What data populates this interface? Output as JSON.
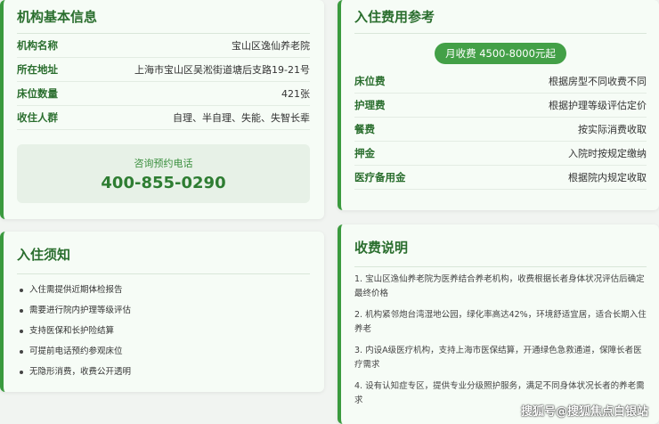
{
  "info": {
    "title": "机构基本信息",
    "rows": [
      {
        "label": "机构名称",
        "value": "宝山区逸仙养老院"
      },
      {
        "label": "所在地址",
        "value": "上海市宝山区吴淞街道塘后支路19-21号"
      },
      {
        "label": "床位数量",
        "value": "421张"
      },
      {
        "label": "收住人群",
        "value": "自理、半自理、失能、失智长辈"
      }
    ],
    "phone_label": "咨询预约电话",
    "phone": "400-855-0290"
  },
  "fees": {
    "title": "入住费用参考",
    "badge": "月收费 4500-8000元起",
    "rows": [
      {
        "label": "床位费",
        "value": "根据房型不同收费不同"
      },
      {
        "label": "护理费",
        "value": "根据护理等级评估定价"
      },
      {
        "label": "餐费",
        "value": "按实际消费收取"
      },
      {
        "label": "押金",
        "value": "入院时按规定缴纳"
      },
      {
        "label": "医疗备用金",
        "value": "根据院内规定收取"
      }
    ]
  },
  "notice": {
    "title": "入住须知",
    "items": [
      "入住需提供近期体检报告",
      "需要进行院内护理等级评估",
      "支持医保和长护险结算",
      "可提前电话预约参观床位",
      "无隐形消费，收费公开透明"
    ]
  },
  "explain": {
    "title": "收费说明",
    "items": [
      "1. 宝山区逸仙养老院为医养结合养老机构，收费根据长者身体状况评估后确定最终价格",
      "2. 机构紧邻炮台湾湿地公园，绿化率高达42%，环境舒适宜居，适合长期入住养老",
      "3. 内设A级医疗机构，支持上海市医保结算，开通绿色急救通道，保障长者医疗需求",
      "4. 设有认知症专区，提供专业分级照护服务，满足不同身体状况长者的养老需求"
    ]
  },
  "watermark": "搜狐号@搜狐焦点白银站",
  "colors": {
    "accent": "#3a9a3e",
    "title": "#2a6e2e",
    "badge": "#43a047"
  }
}
